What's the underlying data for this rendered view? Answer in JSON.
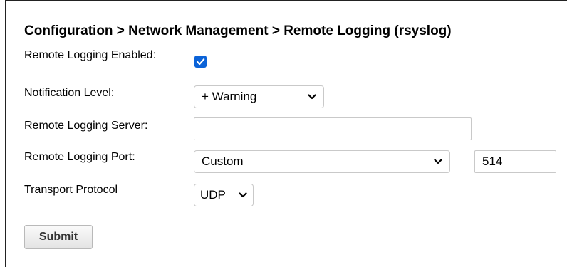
{
  "title": "Configuration > Network Management > Remote Logging (rsyslog)",
  "fields": {
    "remote_logging_enabled": {
      "label": "Remote Logging Enabled:",
      "checked": true
    },
    "notification_level": {
      "label": "Notification Level:",
      "value": "+ Warning"
    },
    "remote_logging_server": {
      "label": "Remote Logging Server:",
      "value": ""
    },
    "remote_logging_port": {
      "label": "Remote Logging Port:",
      "value": "Custom",
      "custom_port": "514"
    },
    "transport_protocol": {
      "label": "Transport Protocol",
      "value": "UDP"
    }
  },
  "submit_label": "Submit",
  "icons": {
    "checkbox": "checkmark-icon",
    "select": "chevron-down-icon"
  },
  "colors": {
    "checkbox_fill": "#0b63d8",
    "field_border": "#c9c9c9"
  }
}
